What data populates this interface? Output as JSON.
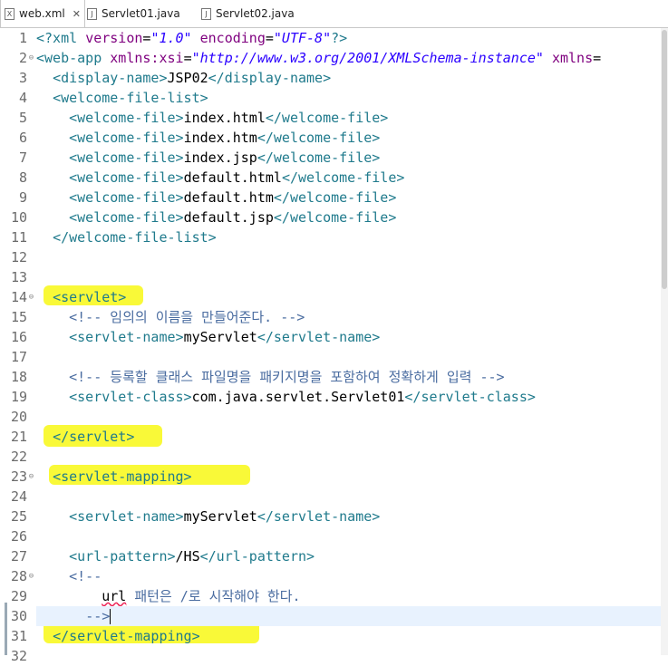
{
  "tabs": [
    {
      "label": "web.xml",
      "icon": "xml-file-icon",
      "active": true,
      "close": "✕"
    },
    {
      "label": "Servlet01.java",
      "icon": "java-file-icon",
      "active": false
    },
    {
      "label": "Servlet02.java",
      "icon": "java-file-icon",
      "active": false
    }
  ],
  "colors": {
    "tag": "#1f7a8c",
    "attribute": "#7f007f",
    "value": "#2a00ff",
    "comment": "#4a6ca0",
    "highlight": "#f7f700",
    "current_line": "#e8f2fe"
  },
  "editor": {
    "current_line": 30,
    "fold_markers": [
      2,
      14,
      23,
      28
    ],
    "lines": [
      {
        "n": "1",
        "tokens": [
          [
            "pi",
            "<?xml "
          ],
          [
            "att",
            "version"
          ],
          [
            "txt",
            "="
          ],
          [
            "val",
            "\"1.0\""
          ],
          [
            "txt",
            " "
          ],
          [
            "att",
            "encoding"
          ],
          [
            "txt",
            "="
          ],
          [
            "val",
            "\"UTF-8\""
          ],
          [
            "pi",
            "?>"
          ]
        ]
      },
      {
        "n": "2",
        "tokens": [
          [
            "tag",
            "<web-app "
          ],
          [
            "att",
            "xmlns:xsi"
          ],
          [
            "txt",
            "="
          ],
          [
            "val",
            "\"http://www.w3.org/2001/XMLSchema-instance\""
          ],
          [
            "txt",
            " "
          ],
          [
            "att",
            "xmlns"
          ],
          [
            "txt",
            "="
          ]
        ]
      },
      {
        "n": "3",
        "tokens": [
          [
            "txt",
            "  "
          ],
          [
            "tag",
            "<display-name>"
          ],
          [
            "txt",
            "JSP02"
          ],
          [
            "tag",
            "</display-name>"
          ]
        ]
      },
      {
        "n": "4",
        "tokens": [
          [
            "txt",
            "  "
          ],
          [
            "tag",
            "<welcome-file-list>"
          ]
        ]
      },
      {
        "n": "5",
        "tokens": [
          [
            "txt",
            "    "
          ],
          [
            "tag",
            "<welcome-file>"
          ],
          [
            "txt",
            "index.html"
          ],
          [
            "tag",
            "</welcome-file>"
          ]
        ]
      },
      {
        "n": "6",
        "tokens": [
          [
            "txt",
            "    "
          ],
          [
            "tag",
            "<welcome-file>"
          ],
          [
            "txt",
            "index.htm"
          ],
          [
            "tag",
            "</welcome-file>"
          ]
        ]
      },
      {
        "n": "7",
        "tokens": [
          [
            "txt",
            "    "
          ],
          [
            "tag",
            "<welcome-file>"
          ],
          [
            "txt",
            "index.jsp"
          ],
          [
            "tag",
            "</welcome-file>"
          ]
        ]
      },
      {
        "n": "8",
        "tokens": [
          [
            "txt",
            "    "
          ],
          [
            "tag",
            "<welcome-file>"
          ],
          [
            "txt",
            "default.html"
          ],
          [
            "tag",
            "</welcome-file>"
          ]
        ]
      },
      {
        "n": "9",
        "tokens": [
          [
            "txt",
            "    "
          ],
          [
            "tag",
            "<welcome-file>"
          ],
          [
            "txt",
            "default.htm"
          ],
          [
            "tag",
            "</welcome-file>"
          ]
        ]
      },
      {
        "n": "10",
        "tokens": [
          [
            "txt",
            "    "
          ],
          [
            "tag",
            "<welcome-file>"
          ],
          [
            "txt",
            "default.jsp"
          ],
          [
            "tag",
            "</welcome-file>"
          ]
        ]
      },
      {
        "n": "11",
        "tokens": [
          [
            "txt",
            "  "
          ],
          [
            "tag",
            "</welcome-file-list>"
          ]
        ]
      },
      {
        "n": "12",
        "tokens": []
      },
      {
        "n": "13",
        "tokens": []
      },
      {
        "n": "14",
        "tokens": [
          [
            "txt",
            "  "
          ],
          [
            "tag",
            "<servlet>"
          ]
        ]
      },
      {
        "n": "15",
        "tokens": [
          [
            "txt",
            "    "
          ],
          [
            "cmt",
            "<!-- 임의의 이름을 만들어준다. -->"
          ]
        ]
      },
      {
        "n": "16",
        "tokens": [
          [
            "txt",
            "    "
          ],
          [
            "tag",
            "<servlet-name>"
          ],
          [
            "txt",
            "myServlet"
          ],
          [
            "tag",
            "</servlet-name>"
          ]
        ]
      },
      {
        "n": "17",
        "tokens": []
      },
      {
        "n": "18",
        "tokens": [
          [
            "txt",
            "    "
          ],
          [
            "cmt",
            "<!-- 등록할 클래스 파일명을 패키지명을 포함하여 정확하게 입력 -->"
          ]
        ]
      },
      {
        "n": "19",
        "tokens": [
          [
            "txt",
            "    "
          ],
          [
            "tag",
            "<servlet-class>"
          ],
          [
            "txt",
            "com.java.servlet.Servlet01"
          ],
          [
            "tag",
            "</servlet-class>"
          ]
        ]
      },
      {
        "n": "20",
        "tokens": []
      },
      {
        "n": "21",
        "tokens": [
          [
            "txt",
            "  "
          ],
          [
            "tag",
            "</servlet>"
          ]
        ]
      },
      {
        "n": "22",
        "tokens": []
      },
      {
        "n": "23",
        "tokens": [
          [
            "txt",
            "  "
          ],
          [
            "tag",
            "<servlet-mapping>"
          ]
        ]
      },
      {
        "n": "24",
        "tokens": []
      },
      {
        "n": "25",
        "tokens": [
          [
            "txt",
            "    "
          ],
          [
            "tag",
            "<servlet-name>"
          ],
          [
            "txt",
            "myServlet"
          ],
          [
            "tag",
            "</servlet-name>"
          ]
        ]
      },
      {
        "n": "26",
        "tokens": []
      },
      {
        "n": "27",
        "tokens": [
          [
            "txt",
            "    "
          ],
          [
            "tag",
            "<url-pattern>"
          ],
          [
            "txt",
            "/HS"
          ],
          [
            "tag",
            "</url-pattern>"
          ]
        ]
      },
      {
        "n": "28",
        "tokens": [
          [
            "txt",
            "    "
          ],
          [
            "cmt",
            "<!--"
          ]
        ]
      },
      {
        "n": "29",
        "tokens": [
          [
            "txt",
            "        "
          ],
          [
            "squig",
            "url"
          ],
          [
            "cmt",
            " 패턴은 /로 시작해야 한다."
          ]
        ]
      },
      {
        "n": "30",
        "tokens": [
          [
            "txt",
            "      "
          ],
          [
            "cmt",
            "-->"
          ],
          [
            "caret",
            ""
          ]
        ]
      },
      {
        "n": "31",
        "tokens": [
          [
            "txt",
            "  "
          ],
          [
            "tag",
            "</servlet-mapping>"
          ]
        ]
      },
      {
        "n": "32",
        "tokens": []
      }
    ]
  }
}
